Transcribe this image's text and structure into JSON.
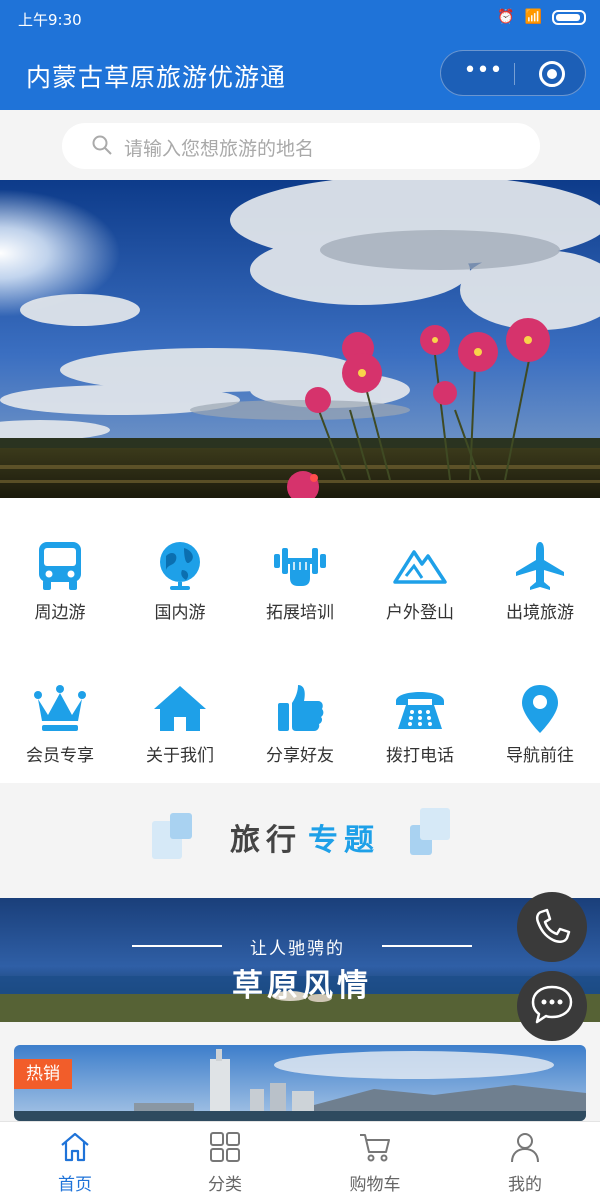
{
  "status_bar": {
    "time": "上午9:30"
  },
  "header": {
    "title": "内蒙古草原旅游优游通"
  },
  "search": {
    "placeholder": "请输入您想旅游的地名"
  },
  "grid_row1": [
    {
      "label": "周边游",
      "icon": "bus-icon"
    },
    {
      "label": "国内游",
      "icon": "globe-icon"
    },
    {
      "label": "拓展培训",
      "icon": "dumbbell-icon"
    },
    {
      "label": "户外登山",
      "icon": "mountain-icon"
    },
    {
      "label": "出境旅游",
      "icon": "airplane-icon"
    }
  ],
  "grid_row2": [
    {
      "label": "会员专享",
      "icon": "crown-icon"
    },
    {
      "label": "关于我们",
      "icon": "home-icon"
    },
    {
      "label": "分享好友",
      "icon": "thumbs-up-icon"
    },
    {
      "label": "拨打电话",
      "icon": "telephone-icon"
    },
    {
      "label": "导航前往",
      "icon": "location-pin-icon"
    }
  ],
  "section": {
    "title_part1": "旅行",
    "title_part2": "专题"
  },
  "promo": {
    "subtitle": "让人驰骋的",
    "title": "草原风情"
  },
  "card": {
    "badge": "热销"
  },
  "tabbar": [
    {
      "label": "首页",
      "icon": "home-outline-icon"
    },
    {
      "label": "分类",
      "icon": "category-grid-icon"
    },
    {
      "label": "购物车",
      "icon": "shopping-cart-icon"
    },
    {
      "label": "我的",
      "icon": "user-icon"
    }
  ],
  "colors": {
    "brand": "#1f73d8",
    "icon_blue": "#1ea0e8",
    "hot_badge": "#f25d2a"
  }
}
